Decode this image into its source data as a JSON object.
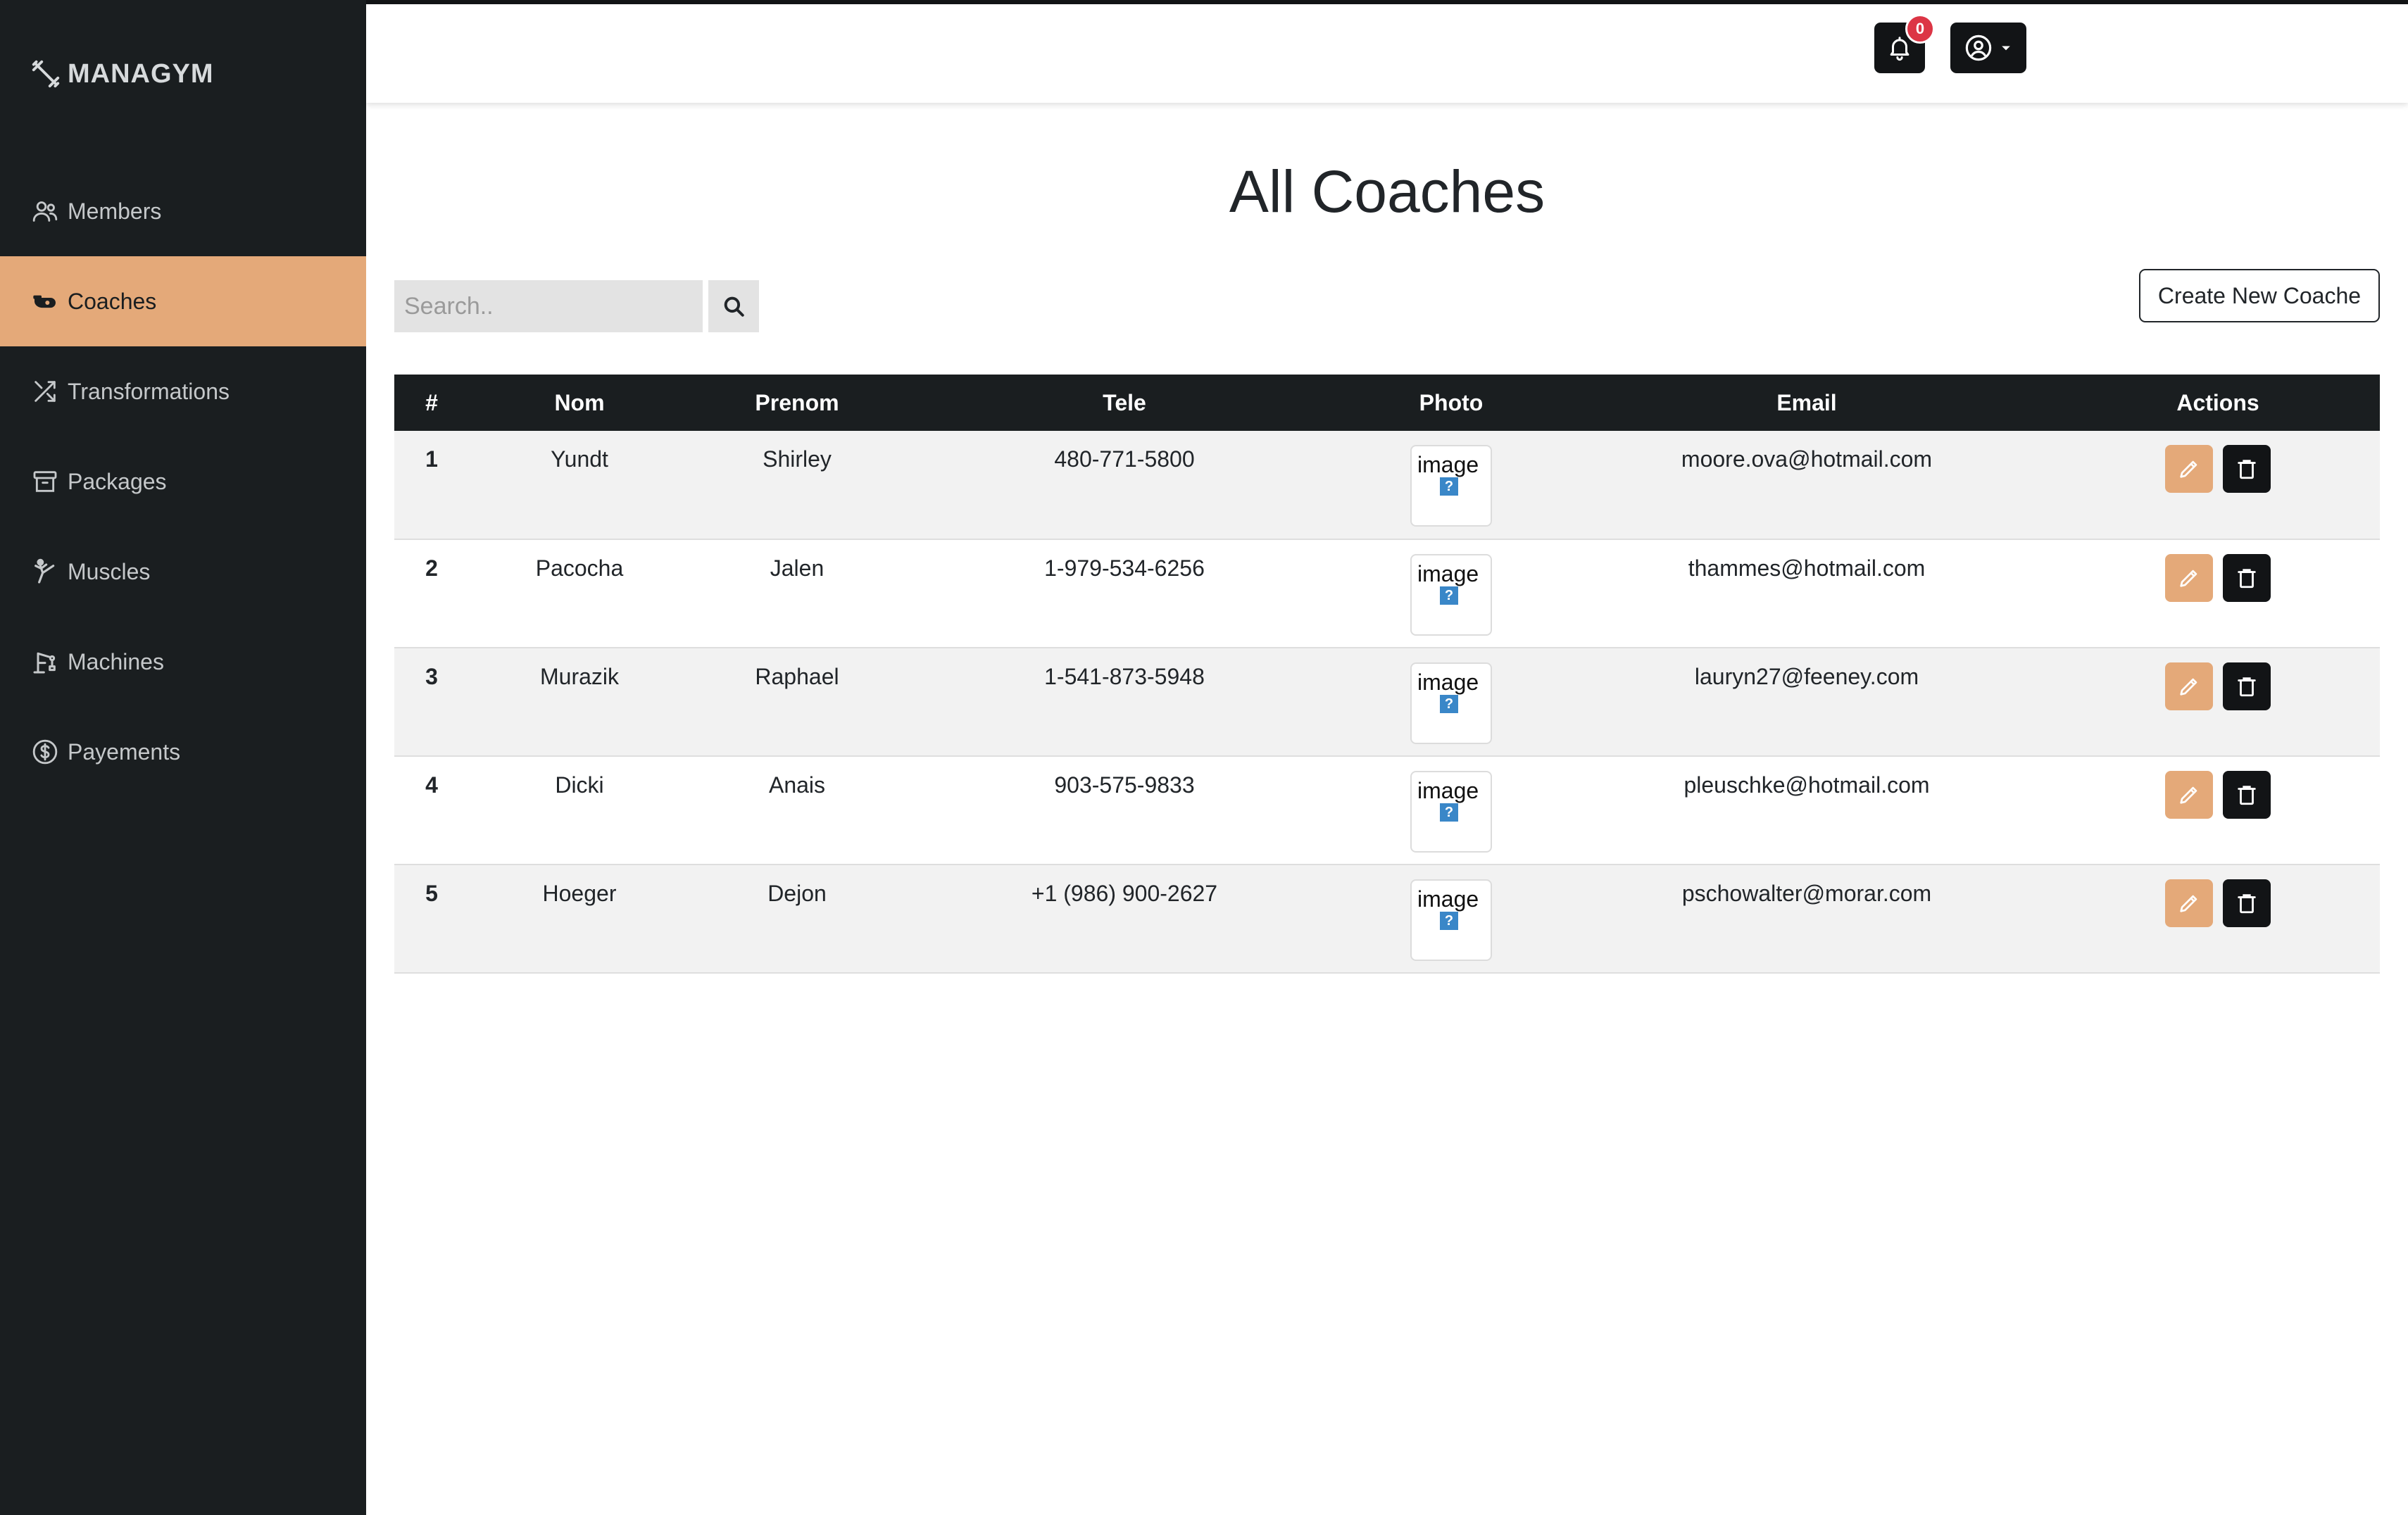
{
  "app": {
    "brand": "MANAGYM"
  },
  "sidebar": {
    "items": [
      {
        "label": "Members",
        "icon": "users-icon",
        "active": false
      },
      {
        "label": "Coaches",
        "icon": "whistle-icon",
        "active": true
      },
      {
        "label": "Transformations",
        "icon": "shuffle-icon",
        "active": false
      },
      {
        "label": "Packages",
        "icon": "archive-box-icon",
        "active": false
      },
      {
        "label": "Muscles",
        "icon": "karate-kick-icon",
        "active": false
      },
      {
        "label": "Machines",
        "icon": "gym-machine-icon",
        "active": false
      },
      {
        "label": "Payements",
        "icon": "dollar-circle-icon",
        "active": false
      }
    ]
  },
  "header": {
    "notifications_count": "0",
    "bell_icon": "bell-icon",
    "user_icon": "user-circle-icon"
  },
  "main": {
    "title": "All Coaches",
    "search": {
      "placeholder": "Search..",
      "value": ""
    },
    "create_button": "Create New Coache"
  },
  "table": {
    "columns": [
      "#",
      "Nom",
      "Prenom",
      "Tele",
      "Photo",
      "Email",
      "Actions"
    ],
    "rows": [
      {
        "id": "1",
        "nom": "Yundt",
        "prenom": "Shirley",
        "tele": "480-771-5800",
        "photo_alt": "image",
        "email": "moore.ova@hotmail.com"
      },
      {
        "id": "2",
        "nom": "Pacocha",
        "prenom": "Jalen",
        "tele": "1-979-534-6256",
        "photo_alt": "image",
        "email": "thammes@hotmail.com"
      },
      {
        "id": "3",
        "nom": "Murazik",
        "prenom": "Raphael",
        "tele": "1-541-873-5948",
        "photo_alt": "image",
        "email": "lauryn27@feeney.com"
      },
      {
        "id": "4",
        "nom": "Dicki",
        "prenom": "Anais",
        "tele": "903-575-9833",
        "photo_alt": "image",
        "email": "pleuschke@hotmail.com"
      },
      {
        "id": "5",
        "nom": "Hoeger",
        "prenom": "Dejon",
        "tele": "+1 (986) 900-2627",
        "photo_alt": "image",
        "email": "pschowalter@morar.com"
      }
    ]
  },
  "colors": {
    "sidebar_bg": "#1a1e20",
    "accent": "#e4a979",
    "dark_button": "#121416",
    "badge": "#dc3545",
    "row_striped": "#f2f2f2"
  }
}
